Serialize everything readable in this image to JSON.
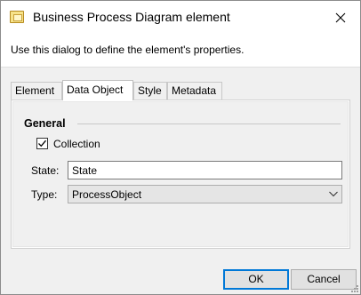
{
  "window": {
    "title": "Business Process Diagram element",
    "title_icon": "element-icon",
    "close_icon": "close-icon"
  },
  "description": "Use this dialog to define the element's properties.",
  "tabs": [
    {
      "label": "Element",
      "active": false
    },
    {
      "label": "Data Object",
      "active": true
    },
    {
      "label": "Style",
      "active": false
    },
    {
      "label": "Metadata",
      "active": false
    }
  ],
  "general": {
    "heading": "General",
    "collection": {
      "label": "Collection",
      "checked": true
    },
    "state": {
      "label": "State:",
      "value": "State"
    },
    "type": {
      "label": "Type:",
      "value": "ProcessObject"
    }
  },
  "buttons": {
    "ok": "OK",
    "cancel": "Cancel"
  },
  "colors": {
    "accent": "#0078d7",
    "dialog_bg": "#f0f0f0"
  }
}
